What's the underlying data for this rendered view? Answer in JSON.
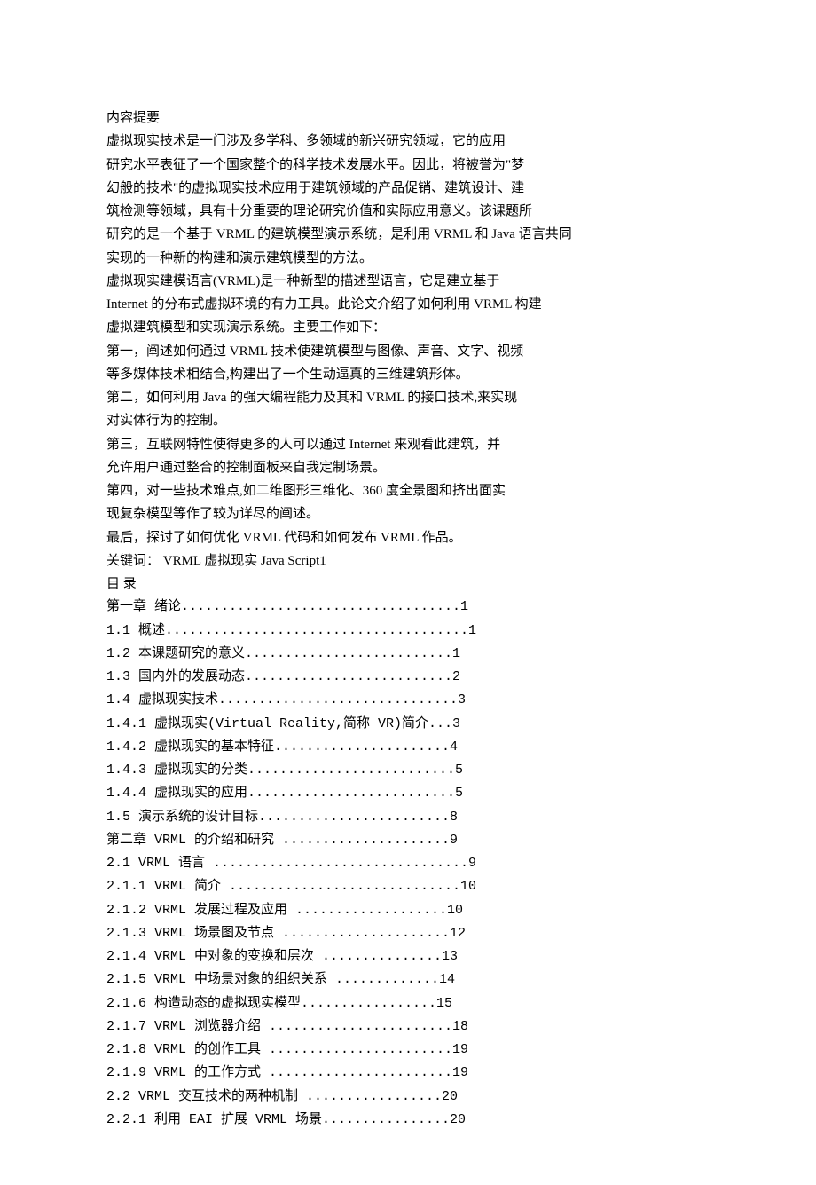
{
  "abstract": {
    "title": "内容提要",
    "lines": [
      "虚拟现实技术是一门涉及多学科、多领域的新兴研究领域，它的应用",
      "研究水平表征了一个国家整个的科学技术发展水平。因此，将被誉为\"梦",
      "幻般的技术\"的虚拟现实技术应用于建筑领域的产品促销、建筑设计、建",
      "筑检测等领域，具有十分重要的理论研究价值和实际应用意义。该课题所",
      "研究的是一个基于 VRML 的建筑模型演示系统，是利用 VRML 和 Java 语言共同",
      "实现的一种新的构建和演示建筑模型的方法。",
      "虚拟现实建模语言(VRML)是一种新型的描述型语言，它是建立基于",
      "Internet 的分布式虚拟环境的有力工具。此论文介绍了如何利用 VRML 构建",
      "虚拟建筑模型和实现演示系统。主要工作如下：",
      "第一，阐述如何通过 VRML 技术使建筑模型与图像、声音、文字、视频",
      "等多媒体技术相结合,构建出了一个生动逼真的三维建筑形体。",
      "第二，如何利用 Java 的强大编程能力及其和 VRML 的接口技术,来实现",
      "对实体行为的控制。",
      "第三，互联网特性使得更多的人可以通过 Internet 来观看此建筑，并",
      "允许用户通过整合的控制面板来自我定制场景。",
      "第四，对一些技术难点,如二维图形三维化、360 度全景图和挤出面实",
      "现复杂模型等作了较为详尽的阐述。",
      "最后，探讨了如何优化 VRML 代码和如何发布 VRML 作品。",
      "关键词： VRML 虚拟现实 Java Script1"
    ]
  },
  "toc": {
    "title": "目 录",
    "entries": [
      {
        "label": "第一章 绪论",
        "page": "1"
      },
      {
        "label": "1.1 概述",
        "page": "1"
      },
      {
        "label": "1.2 本课题研究的意义",
        "page": "1"
      },
      {
        "label": "1.3 国内外的发展动态",
        "page": "2"
      },
      {
        "label": "1.4 虚拟现实技术",
        "page": "3"
      },
      {
        "label": "1.4.1 虚拟现实(Virtual Reality,简称 VR)简介",
        "page": "3"
      },
      {
        "label": "1.4.2 虚拟现实的基本特征",
        "page": "4"
      },
      {
        "label": "1.4.3 虚拟现实的分类",
        "page": "5"
      },
      {
        "label": "1.4.4 虚拟现实的应用",
        "page": "5"
      },
      {
        "label": "1.5 演示系统的设计目标",
        "page": "8"
      },
      {
        "label": "第二章 VRML 的介绍和研究 ",
        "page": "9"
      },
      {
        "label": "2.1 VRML 语言 ",
        "page": "9"
      },
      {
        "label": "2.1.1 VRML 简介 ",
        "page": "10"
      },
      {
        "label": "2.1.2 VRML 发展过程及应用 ",
        "page": "10"
      },
      {
        "label": "2.1.3 VRML 场景图及节点 ",
        "page": "12"
      },
      {
        "label": "2.1.4 VRML 中对象的变换和层次 ",
        "page": "13"
      },
      {
        "label": "2.1.5 VRML 中场景对象的组织关系 ",
        "page": "14"
      },
      {
        "label": "2.1.6 构造动态的虚拟现实模型",
        "page": "15"
      },
      {
        "label": "2.1.7 VRML 浏览器介绍 ",
        "page": "18"
      },
      {
        "label": "2.1.8 VRML 的创作工具 ",
        "page": "19"
      },
      {
        "label": "2.1.9 VRML 的工作方式 ",
        "page": "19"
      },
      {
        "label": "2.2 VRML 交互技术的两种机制 ",
        "page": "20"
      },
      {
        "label": "2.2.1 利用 EAI 扩展 VRML 场景",
        "page": "20"
      }
    ]
  }
}
